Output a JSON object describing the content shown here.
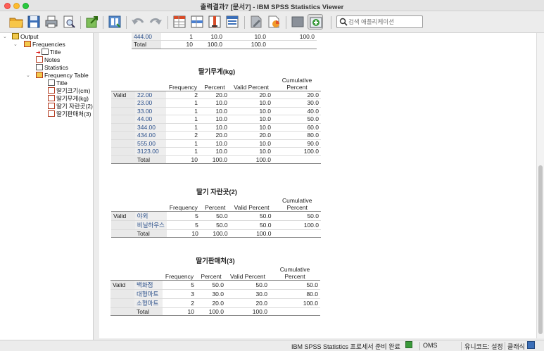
{
  "window": {
    "title": "출력결과7 [문서7] - IBM SPSS Statistics Viewer"
  },
  "search": {
    "placeholder": "검색 애플리케이션"
  },
  "outline": {
    "root": "Output",
    "frequencies": "Frequencies",
    "title": "Title",
    "notes": "Notes",
    "statistics": "Statistics",
    "frequency_table": "Frequency Table",
    "ft_title": "Title",
    "items": [
      "딸기크기(cm)",
      "딸기무게(kg)",
      "딸기 자란곳(2)",
      "딸기판매처(3)"
    ]
  },
  "headers": {
    "frequency": "Frequency",
    "percent": "Percent",
    "valid_percent": "Valid Percent",
    "cumulative": "Cumulative",
    "cumulative2": "Percent"
  },
  "prev_table": {
    "last_row": {
      "label": "444.00",
      "freq": "1",
      "pct": "10.0",
      "vpct": "10.0",
      "cpct": "100.0"
    },
    "total": {
      "label": "Total",
      "freq": "10",
      "pct": "100.0",
      "vpct": "100.0"
    }
  },
  "table_weight": {
    "title": "딸기무게(kg)",
    "valid": "Valid",
    "rows": [
      {
        "label": "22.00",
        "freq": "2",
        "pct": "20.0",
        "vpct": "20.0",
        "cpct": "20.0"
      },
      {
        "label": "23.00",
        "freq": "1",
        "pct": "10.0",
        "vpct": "10.0",
        "cpct": "30.0"
      },
      {
        "label": "33.00",
        "freq": "1",
        "pct": "10.0",
        "vpct": "10.0",
        "cpct": "40.0"
      },
      {
        "label": "44.00",
        "freq": "1",
        "pct": "10.0",
        "vpct": "10.0",
        "cpct": "50.0"
      },
      {
        "label": "344.00",
        "freq": "1",
        "pct": "10.0",
        "vpct": "10.0",
        "cpct": "60.0"
      },
      {
        "label": "434.00",
        "freq": "2",
        "pct": "20.0",
        "vpct": "20.0",
        "cpct": "80.0"
      },
      {
        "label": "555.00",
        "freq": "1",
        "pct": "10.0",
        "vpct": "10.0",
        "cpct": "90.0"
      },
      {
        "label": "3123.00",
        "freq": "1",
        "pct": "10.0",
        "vpct": "10.0",
        "cpct": "100.0"
      }
    ],
    "total": {
      "label": "Total",
      "freq": "10",
      "pct": "100.0",
      "vpct": "100.0"
    }
  },
  "table_place": {
    "title": "딸기 자란곳(2)",
    "valid": "Valid",
    "rows": [
      {
        "label": "야외",
        "freq": "5",
        "pct": "50.0",
        "vpct": "50.0",
        "cpct": "50.0"
      },
      {
        "label": "비닐하우스",
        "freq": "5",
        "pct": "50.0",
        "vpct": "50.0",
        "cpct": "100.0"
      }
    ],
    "total": {
      "label": "Total",
      "freq": "10",
      "pct": "100.0",
      "vpct": "100.0"
    }
  },
  "table_seller": {
    "title": "딸기판매처(3)",
    "valid": "Valid",
    "rows": [
      {
        "label": "백화점",
        "freq": "5",
        "pct": "50.0",
        "vpct": "50.0",
        "cpct": "50.0"
      },
      {
        "label": "대형마트",
        "freq": "3",
        "pct": "30.0",
        "vpct": "30.0",
        "cpct": "80.0"
      },
      {
        "label": "소형마트",
        "freq": "2",
        "pct": "20.0",
        "vpct": "20.0",
        "cpct": "100.0"
      }
    ],
    "total": {
      "label": "Total",
      "freq": "10",
      "pct": "100.0",
      "vpct": "100.0"
    }
  },
  "status": {
    "processor": "IBM SPSS Statistics 프로세서 준비 완료",
    "oms": "OMS",
    "unicode": "유니코드: 설정",
    "classic": "클래식"
  },
  "colors": {
    "accent": "#2a4f8a",
    "status_green": "#3a9a3a"
  }
}
